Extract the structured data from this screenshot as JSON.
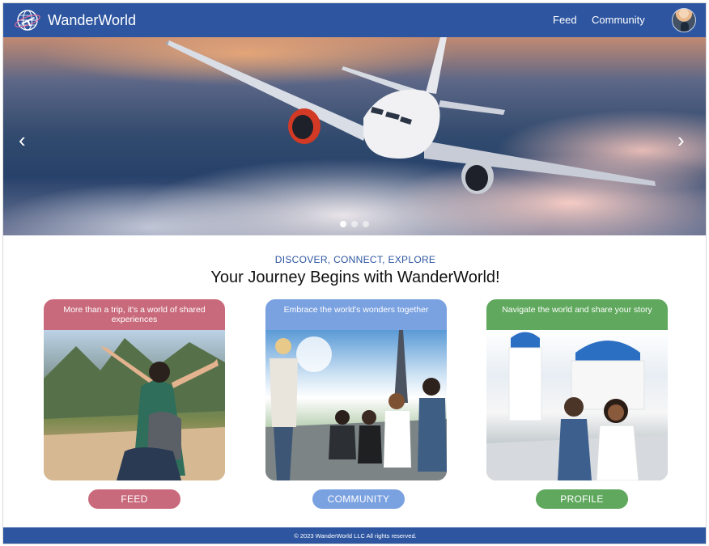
{
  "header": {
    "brand": "WanderWorld",
    "nav": [
      "Feed",
      "Community"
    ],
    "logo_icon": "globe-airplane-icon",
    "avatar_icon": "user-avatar"
  },
  "hero": {
    "prev_glyph": "‹",
    "next_glyph": "›",
    "slides": 3,
    "active_slide": 1,
    "image": "airplane above clouds"
  },
  "section": {
    "tagline": "DISCOVER, CONNECT, EXPLORE",
    "headline": "Your Journey Begins with WanderWorld!"
  },
  "cards": [
    {
      "caption": "More than a trip, it's a world of shared experiences",
      "button": "FEED",
      "color": "#c96a7c",
      "image": "traveler with arms raised at mountain ruins"
    },
    {
      "caption": "Embrace the world's wonders together",
      "button": "COMMUNITY",
      "color": "#7aa1e0",
      "image": "group of friends near Eiffel Tower"
    },
    {
      "caption": "Navigate the world and share your story",
      "button": "PROFILE",
      "color": "#5fa85d",
      "image": "couple in Santorini"
    }
  ],
  "footer": {
    "copyright": "© 2023 WanderWorld LLC All rights reserved."
  },
  "colors": {
    "primary": "#2d55a0",
    "feed": "#c96a7c",
    "community": "#7aa1e0",
    "profile": "#5fa85d"
  }
}
